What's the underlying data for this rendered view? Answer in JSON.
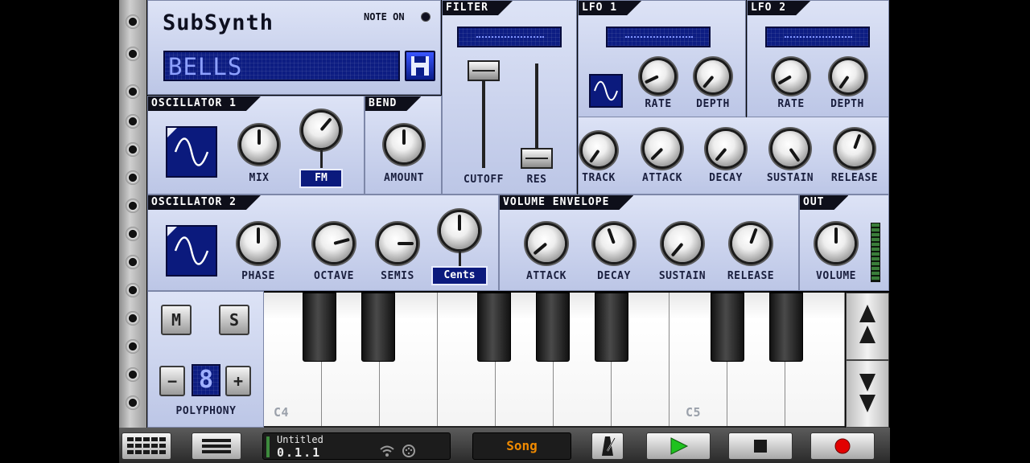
{
  "app": {
    "title": "SubSynth",
    "note_on_label": "NOTE ON",
    "preset_name": "BELLS"
  },
  "filter": {
    "title": "FILTER",
    "cutoff_label": "CUTOFF",
    "res_label": "RES"
  },
  "lfo1": {
    "title": "LFO 1",
    "rate_label": "RATE",
    "depth_label": "DEPTH"
  },
  "lfo2": {
    "title": "LFO 2",
    "rate_label": "RATE",
    "depth_label": "DEPTH"
  },
  "filter_env": {
    "track_label": "TRACK",
    "attack_label": "ATTACK",
    "decay_label": "DECAY",
    "sustain_label": "SUSTAIN",
    "release_label": "RELEASE"
  },
  "osc1": {
    "title": "OSCILLATOR 1",
    "mix_label": "MIX",
    "fm_label": "FM"
  },
  "bend": {
    "title": "BEND",
    "amount_label": "AMOUNT"
  },
  "osc2": {
    "title": "OSCILLATOR 2",
    "phase_label": "PHASE",
    "octave_label": "OCTAVE",
    "semis_label": "SEMIS",
    "cents_label": "Cents"
  },
  "vol_env": {
    "title": "VOLUME ENVELOPE",
    "attack_label": "ATTACK",
    "decay_label": "DECAY",
    "sustain_label": "SUSTAIN",
    "release_label": "RELEASE"
  },
  "out": {
    "title": "OUT",
    "volume_label": "VOLUME"
  },
  "voice": {
    "mute_label": "M",
    "solo_label": "S",
    "minus_label": "−",
    "plus_label": "+",
    "polyphony_value": "8",
    "polyphony_label": "POLYPHONY"
  },
  "keyboard": {
    "c4_label": "C4",
    "c5_label": "C5"
  },
  "transport": {
    "song_title": "Untitled",
    "position": "0.1.1",
    "song_button": "Song"
  },
  "colors": {
    "panel": "#c9d1ee",
    "lcd": "#0d1d82",
    "title_bar": "#0e0f1a",
    "song_text": "#f08a00",
    "play": "#1fc21f",
    "record": "#e20000"
  },
  "icons": [
    "floppy-disk-icon",
    "sine-wave-icon",
    "grid-icon",
    "menu-icon",
    "wifi-icon",
    "midi-icon",
    "metronome-icon",
    "play-icon",
    "stop-icon",
    "record-icon",
    "octave-up-icon",
    "octave-down-icon"
  ]
}
